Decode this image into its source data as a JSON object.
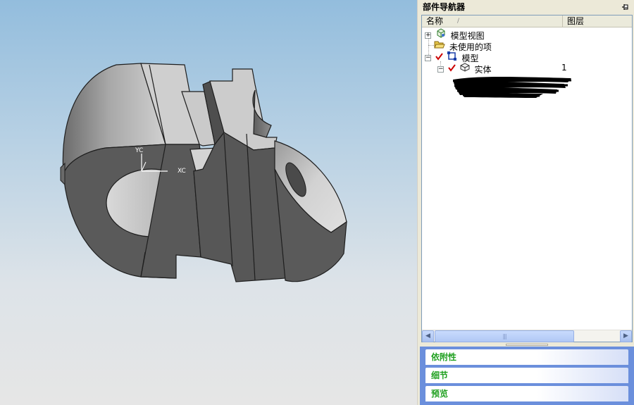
{
  "viewport": {
    "axis_labels": {
      "y": "YC",
      "x": "XC"
    }
  },
  "navigator": {
    "title": "部件导航器",
    "pin_icon": "pin-icon",
    "columns": {
      "name": "名称",
      "sort_indicator": "/",
      "layer": "图层"
    },
    "tree": [
      {
        "label": "模型视图",
        "expander": "+",
        "icon": "model-views-icon"
      },
      {
        "label": "未使用的项",
        "icon": "open-folder-icon"
      },
      {
        "label": "模型",
        "expander": "−",
        "icon": "model-icon",
        "checked": true
      },
      {
        "label": "实体",
        "expander": "−",
        "icon": "solid-body-icon",
        "checked": true,
        "layer": "1"
      }
    ],
    "scrollbar": {
      "thumb_grip": "|||"
    },
    "panels": [
      {
        "label": "依附性"
      },
      {
        "label": "细节"
      },
      {
        "label": "预览"
      }
    ],
    "colors": {
      "panel_text": "#21a121",
      "panel_bg": "#6b8fdc",
      "check": "#cc0000"
    }
  }
}
